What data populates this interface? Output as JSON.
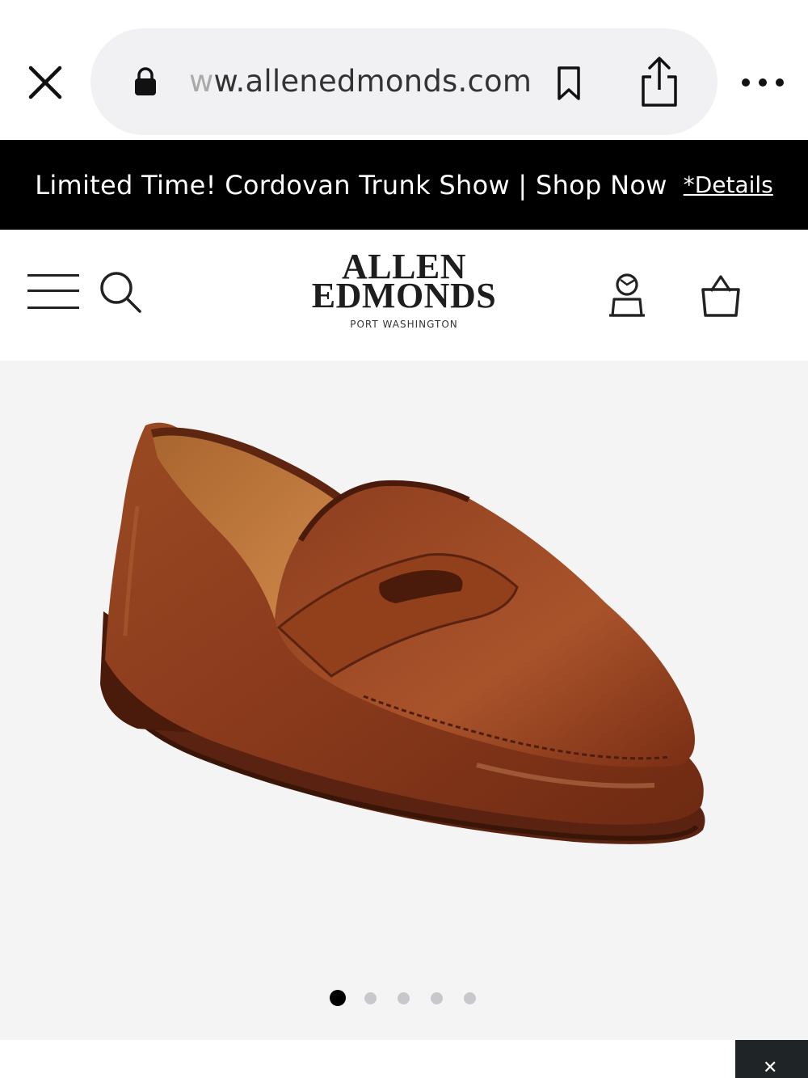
{
  "browser": {
    "url_faded": "w",
    "url_main": "w.allenedmonds.com"
  },
  "promo": {
    "text": "Limited Time! Cordovan Trunk Show | Shop Now",
    "details_link": "*Details"
  },
  "header": {
    "logo_line1": "ALLEN",
    "logo_line2": "EDMONDS",
    "logo_sub": "PORT WASHINGTON"
  },
  "gallery": {
    "image_alt": "Brown leather penny loafer",
    "slide_count": 5,
    "active_slide": 1
  },
  "colors": {
    "banner_bg": "#000000",
    "gallery_bg": "#f4f4f5",
    "leather": "#8a3d1f",
    "dot_active": "#000000",
    "dot_inactive": "#c8c8cc"
  }
}
